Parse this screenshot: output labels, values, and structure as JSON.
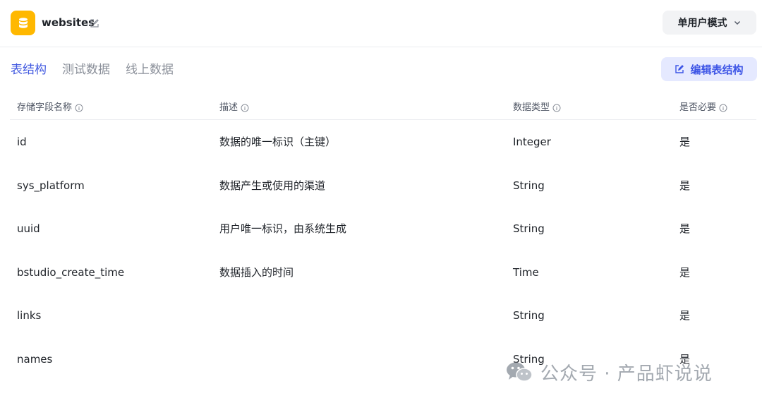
{
  "header": {
    "title": "websites",
    "mode_label": "单用户模式"
  },
  "tabs": [
    {
      "label": "表结构",
      "active": true
    },
    {
      "label": "测试数据",
      "active": false
    },
    {
      "label": "线上数据",
      "active": false
    }
  ],
  "toolbar": {
    "edit_schema_label": "编辑表结构"
  },
  "table": {
    "columns": [
      "存储字段名称",
      "描述",
      "数据类型",
      "是否必要"
    ],
    "rows": [
      {
        "name": "id",
        "desc": "数据的唯一标识（主键）",
        "type": "Integer",
        "required": "是"
      },
      {
        "name": "sys_platform",
        "desc": "数据产生或使用的渠道",
        "type": "String",
        "required": "是"
      },
      {
        "name": "uuid",
        "desc": "用户唯一标识，由系统生成",
        "type": "String",
        "required": "是"
      },
      {
        "name": "bstudio_create_time",
        "desc": "数据插入的时间",
        "type": "Time",
        "required": "是"
      },
      {
        "name": "links",
        "desc": "",
        "type": "String",
        "required": "是"
      },
      {
        "name": "names",
        "desc": "",
        "type": "String",
        "required": "是"
      }
    ]
  },
  "watermark": {
    "text": "公众号 · 产品虾说说"
  },
  "colors": {
    "accent": "#4159e0",
    "logo_bg": "#ffb800",
    "button_bg": "#e5e9ff"
  }
}
